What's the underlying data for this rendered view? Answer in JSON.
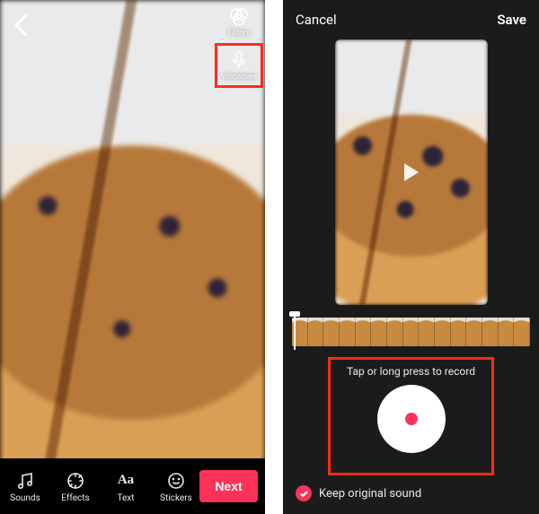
{
  "left": {
    "tools": {
      "filters": "Filters",
      "voiceover": "Voiceover"
    },
    "bottom": {
      "sounds": "Sounds",
      "effects": "Effects",
      "text": "Text",
      "text_icon": "Aa",
      "stickers": "Stickers",
      "next": "Next"
    }
  },
  "right": {
    "cancel": "Cancel",
    "save": "Save",
    "record_hint": "Tap or long press to record",
    "keep_original": "Keep original sound"
  }
}
